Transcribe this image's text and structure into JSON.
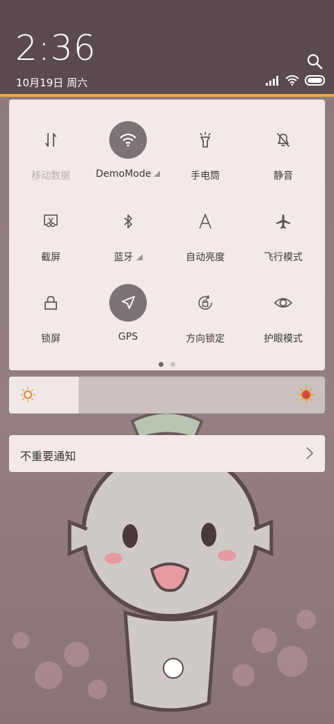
{
  "status_bar": {
    "time": "2:36",
    "date": "10月19日 周六",
    "icons": [
      "signal-icon",
      "wifi-icon",
      "battery-icon"
    ]
  },
  "header": {
    "search_icon": "search-icon"
  },
  "quick_settings": {
    "tiles": [
      {
        "label": "移动数据",
        "icon": "mobile-data-icon",
        "active": false,
        "disabled": true
      },
      {
        "label": "DemoMode",
        "icon": "wifi-icon",
        "active": true,
        "expandable": true
      },
      {
        "label": "手电筒",
        "icon": "flashlight-icon",
        "active": false
      },
      {
        "label": "静音",
        "icon": "mute-icon",
        "active": false
      },
      {
        "label": "截屏",
        "icon": "screenshot-icon",
        "active": false
      },
      {
        "label": "蓝牙",
        "icon": "bluetooth-icon",
        "active": false,
        "expandable": true
      },
      {
        "label": "自动亮度",
        "icon": "auto-brightness-icon",
        "active": false
      },
      {
        "label": "飞行模式",
        "icon": "airplane-icon",
        "active": false
      },
      {
        "label": "锁屏",
        "icon": "lock-icon",
        "active": false
      },
      {
        "label": "GPS",
        "icon": "location-icon",
        "active": true
      },
      {
        "label": "方向锁定",
        "icon": "rotation-lock-icon",
        "active": false
      },
      {
        "label": "护眼模式",
        "icon": "eye-icon",
        "active": false
      }
    ],
    "page_indicator": {
      "pages": 2,
      "current": 1
    }
  },
  "brightness": {
    "level": 0.22,
    "low_icon": "sun-low-icon",
    "high_icon": "sun-high-icon"
  },
  "notifications": {
    "unimportant_label": "不重要通知"
  },
  "colors": {
    "accent": "#f0a83a",
    "panel": "#f2e9e8",
    "active_tile": "#7d7276"
  }
}
